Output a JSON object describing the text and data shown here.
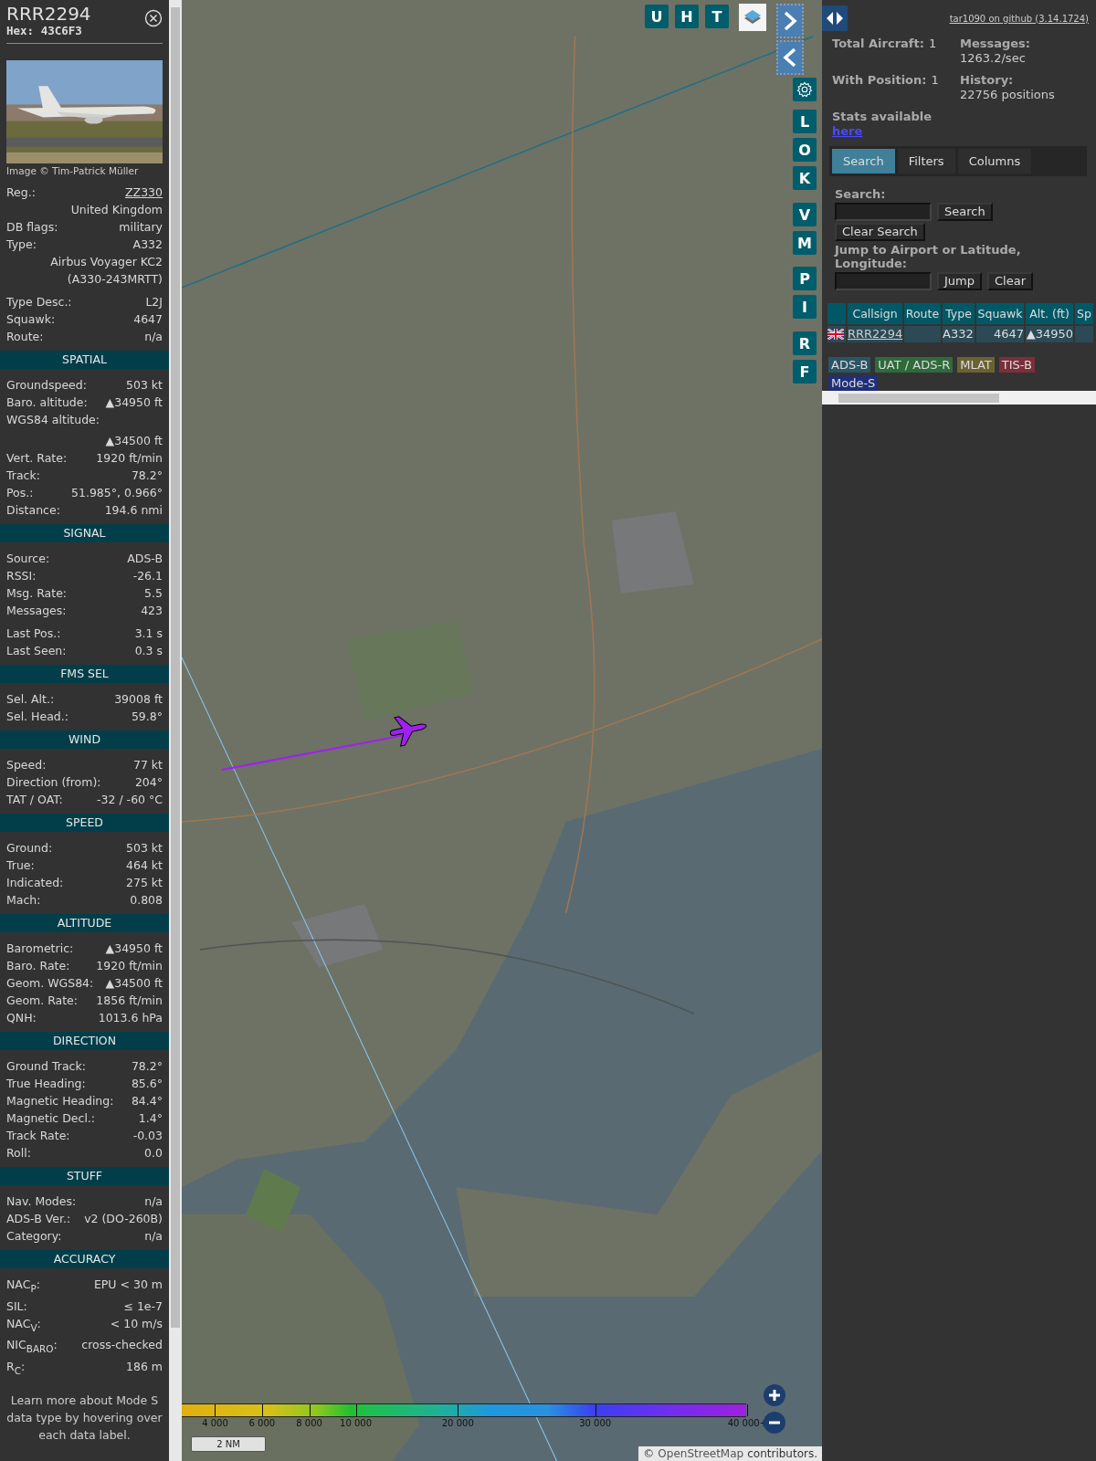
{
  "aircraft_panel": {
    "callsign": "RRR2294",
    "hex": "Hex: 43C6F3",
    "photo": {
      "kind": "picture",
      "credit": "Image © Tim-Patrick Müller"
    },
    "details": [
      [
        {
          "kind": "link",
          "label": "Reg.:",
          "value": "ZZ330"
        },
        {
          "kind": "value_only",
          "value": "United Kingdom"
        },
        {
          "kind": "pair",
          "label": "DB flags:",
          "value": "military"
        },
        {
          "kind": "pair",
          "label": "Type:",
          "value": "A332"
        },
        {
          "kind": "value_only",
          "value": "Airbus Voyager KC2 (A330-243MRTT)"
        }
      ],
      [
        {
          "kind": "pair",
          "label": "Type Desc.:",
          "value": "L2J"
        },
        {
          "kind": "pair",
          "label": "Squawk:",
          "value": "4647"
        },
        {
          "kind": "pair",
          "label": "Route:",
          "value": "n/a"
        }
      ]
    ],
    "sections": [
      {
        "title": "SPATIAL",
        "groups": [
          [
            {
              "kind": "pair",
              "label": "Groundspeed:",
              "value": "503 kt"
            },
            {
              "kind": "pair",
              "label": "Baro. altitude:",
              "value": "▲34950 ft"
            },
            {
              "kind": "stacked",
              "label": "WGS84 altitude:",
              "value": "▲34500 ft"
            },
            {
              "kind": "pair",
              "label": "Vert. Rate:",
              "value": "1920 ft/min"
            },
            {
              "kind": "pair",
              "label": "Track:",
              "value": "78.2°"
            },
            {
              "kind": "pair",
              "label": "Pos.:",
              "value": "51.985°, 0.966°"
            },
            {
              "kind": "pair",
              "label": "Distance:",
              "value": "194.6 nmi"
            }
          ]
        ]
      },
      {
        "title": "SIGNAL",
        "groups": [
          [
            {
              "kind": "pair",
              "label": "Source:",
              "value": "ADS-B"
            },
            {
              "kind": "pair",
              "label": "RSSI:",
              "value": "-26.1"
            },
            {
              "kind": "pair",
              "label": "Msg. Rate:",
              "value": "5.5"
            },
            {
              "kind": "pair",
              "label": "Messages:",
              "value": "423"
            }
          ],
          [
            {
              "kind": "pair",
              "label": "Last Pos.:",
              "value": "3.1 s"
            },
            {
              "kind": "pair",
              "label": "Last Seen:",
              "value": "0.3 s"
            }
          ]
        ]
      },
      {
        "title": "FMS SEL",
        "groups": [
          [
            {
              "kind": "pair",
              "label": "Sel. Alt.:",
              "value": "39008 ft"
            },
            {
              "kind": "pair",
              "label": "Sel. Head.:",
              "value": "59.8°"
            }
          ]
        ]
      },
      {
        "title": "WIND",
        "groups": [
          [
            {
              "kind": "pair",
              "label": "Speed:",
              "value": "77 kt"
            },
            {
              "kind": "pair",
              "label": "Direction (from):",
              "value": "204°"
            },
            {
              "kind": "pair",
              "label": "TAT / OAT:",
              "value": "-32 / -60 °C"
            }
          ]
        ]
      },
      {
        "title": "SPEED",
        "groups": [
          [
            {
              "kind": "pair",
              "label": "Ground:",
              "value": "503 kt"
            },
            {
              "kind": "pair",
              "label": "True:",
              "value": "464 kt"
            },
            {
              "kind": "pair",
              "label": "Indicated:",
              "value": "275 kt"
            },
            {
              "kind": "pair",
              "label": "Mach:",
              "value": "0.808"
            }
          ]
        ]
      },
      {
        "title": "ALTITUDE",
        "groups": [
          [
            {
              "kind": "pair",
              "label": "Barometric:",
              "value": "▲34950 ft"
            },
            {
              "kind": "pair",
              "label": "Baro. Rate:",
              "value": "1920 ft/min"
            },
            {
              "kind": "pair",
              "label": "Geom. WGS84:",
              "value": "▲34500 ft"
            },
            {
              "kind": "pair",
              "label": "Geom. Rate:",
              "value": "1856 ft/min"
            },
            {
              "kind": "pair",
              "label": "QNH:",
              "value": "1013.6 hPa"
            }
          ]
        ]
      },
      {
        "title": "DIRECTION",
        "groups": [
          [
            {
              "kind": "pair",
              "label": "Ground Track:",
              "value": "78.2°"
            },
            {
              "kind": "pair",
              "label": "True Heading:",
              "value": "85.6°"
            },
            {
              "kind": "pair",
              "label": "Magnetic Heading:",
              "value": "84.4°"
            },
            {
              "kind": "pair",
              "label": "Magnetic Decl.:",
              "value": "1.4°"
            },
            {
              "kind": "pair",
              "label": "Track Rate:",
              "value": "-0.03"
            },
            {
              "kind": "pair",
              "label": "Roll:",
              "value": "0.0"
            }
          ]
        ]
      },
      {
        "title": "STUFF",
        "groups": [
          [
            {
              "kind": "pair",
              "label": "Nav. Modes:",
              "value": "n/a"
            },
            {
              "kind": "pair",
              "label": "ADS-B Ver.:",
              "value": "v2 (DO-260B)"
            },
            {
              "kind": "pair",
              "label": "Category:",
              "value": "n/a"
            }
          ]
        ]
      },
      {
        "title": "ACCURACY",
        "groups": [
          [
            {
              "kind": "pair",
              "label": "NAC$_{P}$:",
              "value": "EPU < 30 m"
            },
            {
              "kind": "pair",
              "label": "SIL:",
              "value": "≤ 1e-7"
            },
            {
              "kind": "pair",
              "label": "NAC$_{V}$:",
              "value": "< 10 m/s"
            },
            {
              "kind": "pair",
              "label": "NIC$_{BARO}$:",
              "value": "cross-checked"
            },
            {
              "kind": "pair",
              "label": "R$_{C}$:",
              "value": "186 m"
            }
          ]
        ]
      }
    ],
    "footer": "Learn more about Mode S data type by hovering over each data label."
  },
  "map": {
    "top_buttons": [
      "U",
      "H",
      "T"
    ],
    "side_buttons": [
      [
        "L",
        "O",
        "K"
      ],
      [
        "V",
        "M"
      ],
      [
        "P",
        "I"
      ],
      [
        "R",
        "F"
      ]
    ],
    "altitude_legend": [
      "4 000",
      "6 000",
      "8 000",
      "10 000",
      "20 000",
      "30 000",
      "40 000+"
    ],
    "scale": "2 NM",
    "attribution": {
      "prefix": "©",
      "link": "OpenStreetMap",
      "suffix": "contributors."
    }
  },
  "side_panel": {
    "version_link": "tar1090 on github (3.14.1724)",
    "stats": [
      {
        "label": "Total Aircraft:",
        "value": "1"
      },
      {
        "label": "Messages:",
        "value": "1263.2/sec"
      },
      {
        "label": "With Position:",
        "value": "1"
      },
      {
        "label": "History:",
        "value": "22756 positions"
      }
    ],
    "stats_note": {
      "text": "Stats available",
      "link": "here"
    },
    "tabs": [
      {
        "label": "Search",
        "selected": true
      },
      {
        "label": "Filters",
        "selected": false
      },
      {
        "label": "Columns",
        "selected": false
      }
    ],
    "search": {
      "label": "Search:",
      "button": "Search",
      "clear_button": "Clear Search"
    },
    "jump": {
      "label": "Jump to Airport or Latitude, Longitude:",
      "button": "Jump",
      "clear_button": "Clear"
    },
    "table": {
      "columns": [
        "Callsign",
        "Route",
        "Type",
        "Squawk",
        "Alt. (ft)",
        "Sp"
      ],
      "rows": [
        {
          "callsign": "RRR2294",
          "type": "A332",
          "squawk": "4647",
          "altitude": "▲34950"
        }
      ]
    },
    "legend": [
      {
        "label": "ADS-B",
        "color": "#2a5566"
      },
      {
        "label": "UAT / ADS-R",
        "color": "#2e6a3a"
      },
      {
        "label": "MLAT",
        "color": "#6a6232"
      },
      {
        "label": "TIS-B",
        "color": "#7a2f3a"
      },
      {
        "label": "Mode-S",
        "color": "#1f2f78"
      }
    ]
  }
}
